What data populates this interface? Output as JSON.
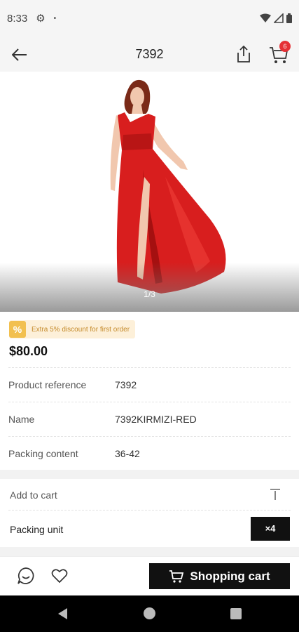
{
  "status": {
    "time": "8:33",
    "dot": "•"
  },
  "header": {
    "title": "7392",
    "cart_count": "6"
  },
  "gallery": {
    "pager": "1/3"
  },
  "promo": {
    "icon": "%",
    "text": "Extra 5% discount for first order"
  },
  "product": {
    "price": "$80.00",
    "rows": [
      {
        "key": "Product reference",
        "value": "7392"
      },
      {
        "key": "Name",
        "value": "7392KIRMIZI-RED"
      },
      {
        "key": "Packing content",
        "value": "36-42"
      }
    ]
  },
  "cart_section": {
    "add_label": "Add to cart",
    "unit_label": "Packing unit",
    "unit_qty": "×4"
  },
  "bottom": {
    "cart_button": "Shopping cart"
  },
  "colors": {
    "accent": "#111111",
    "badge": "#e53035",
    "dress": "#d81e1e",
    "promo_bg": "#fdf0d9",
    "promo_icon": "#f2c04f"
  }
}
